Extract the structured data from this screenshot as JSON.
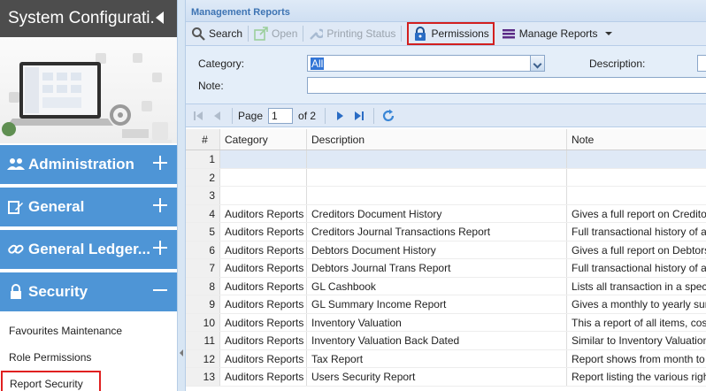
{
  "sidebar": {
    "title": "System Configurati...",
    "sections": [
      {
        "label": "Administration",
        "state": "collapsed",
        "icon": "users-icon"
      },
      {
        "label": "General",
        "state": "collapsed",
        "icon": "edit-icon"
      },
      {
        "label": "General Ledger...",
        "state": "collapsed",
        "icon": "link-icon"
      },
      {
        "label": "Security",
        "state": "expanded",
        "icon": "lock-icon"
      }
    ],
    "security_items": [
      "Favourites Maintenance",
      "Role Permissions",
      "Report Security"
    ]
  },
  "panel": {
    "title": "Management Reports"
  },
  "toolbar": {
    "search": "Search",
    "open": "Open",
    "printing_status": "Printing Status",
    "permissions": "Permissions",
    "manage_reports": "Manage Reports"
  },
  "filters": {
    "category_label": "Category:",
    "category_value": "All",
    "description_label": "Description:",
    "note_label": "Note:"
  },
  "pager": {
    "page_label": "Page",
    "page_value": "1",
    "of_label": "of 2"
  },
  "grid": {
    "columns": [
      "#",
      "Category",
      "Description",
      "Note"
    ],
    "rows": [
      {
        "num": "1",
        "category": "",
        "description": "",
        "note": ""
      },
      {
        "num": "2",
        "category": "",
        "description": "",
        "note": ""
      },
      {
        "num": "3",
        "category": "",
        "description": "",
        "note": ""
      },
      {
        "num": "4",
        "category": "Auditors Reports",
        "description": "Creditors Document History",
        "note": "Gives a full report on Creditors I"
      },
      {
        "num": "5",
        "category": "Auditors Reports",
        "description": "Creditors Journal Transactions Report",
        "note": "Full transactional history of all p"
      },
      {
        "num": "6",
        "category": "Auditors Reports",
        "description": "Debtors Document History",
        "note": "Gives a full report on Debtors D"
      },
      {
        "num": "7",
        "category": "Auditors Reports",
        "description": "Debtors Journal Trans Report",
        "note": "Full transactional history of all p"
      },
      {
        "num": "8",
        "category": "Auditors Reports",
        "description": "GL Cashbook",
        "note": "Lists all transaction in a specific"
      },
      {
        "num": "9",
        "category": "Auditors Reports",
        "description": "GL Summary Income Report",
        "note": "Gives a monthly to yearly summ"
      },
      {
        "num": "10",
        "category": "Auditors Reports",
        "description": "Inventory Valuation",
        "note": "This a report of all items, cost m"
      },
      {
        "num": "11",
        "category": "Auditors Reports",
        "description": "Inventory Valuation Back Dated",
        "note": "Similar to Inventory Valuation re"
      },
      {
        "num": "12",
        "category": "Auditors Reports",
        "description": "Tax Report",
        "note": "Report shows from month to me"
      },
      {
        "num": "13",
        "category": "Auditors Reports",
        "description": "Users Security Report",
        "note": "Report listing the various rights"
      }
    ]
  },
  "colors": {
    "sidebar_section": "#4e95d6",
    "sidebar_title": "#4d4d4d",
    "highlight": "#d21f1f",
    "panel_title": "#3e74b3"
  }
}
